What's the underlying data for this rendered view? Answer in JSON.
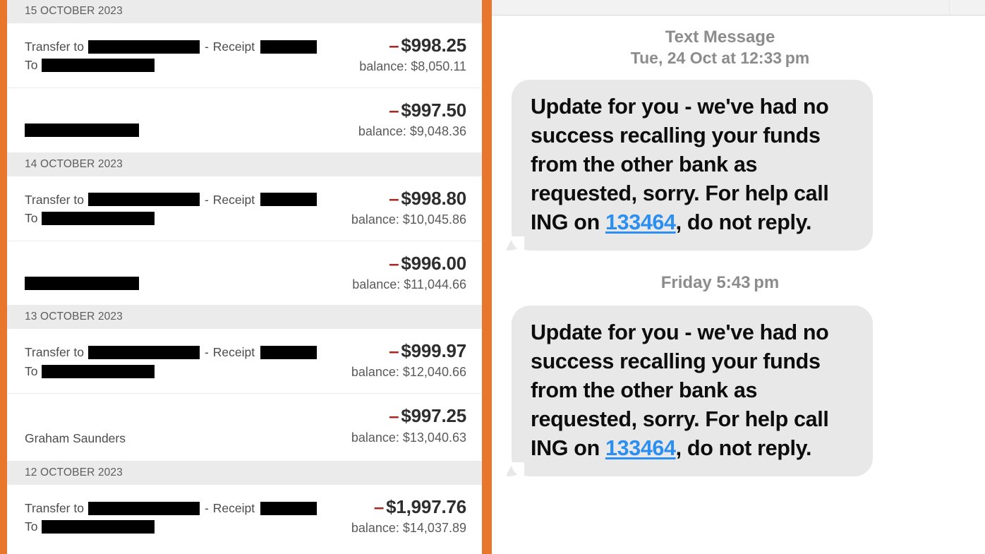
{
  "left_panel": {
    "name": "bank-transaction-list",
    "accent_color": "#e8762c",
    "date_header_bg": "#ebebeb",
    "amount_minus_color": "#a62a22",
    "groups": [
      {
        "date": "15 OCTOBER 2023",
        "transactions": [
          {
            "type": "transfer",
            "transfer_label": "Transfer to",
            "separator": "-",
            "receipt_label": "Receipt",
            "to_label": "To",
            "payee": "",
            "redacted": true,
            "minus": "–",
            "amount": "$998.25",
            "balance": "balance: $8,050.11"
          },
          {
            "type": "payee",
            "payee": "",
            "redacted": true,
            "minus": "–",
            "amount": "$997.50",
            "balance": "balance: $9,048.36"
          }
        ]
      },
      {
        "date": "14 OCTOBER 2023",
        "transactions": [
          {
            "type": "transfer",
            "transfer_label": "Transfer to",
            "separator": "-",
            "receipt_label": "Receipt",
            "to_label": "To",
            "payee": "",
            "redacted": true,
            "minus": "–",
            "amount": "$998.80",
            "balance": "balance: $10,045.86"
          },
          {
            "type": "payee",
            "payee": "",
            "redacted": true,
            "minus": "–",
            "amount": "$996.00",
            "balance": "balance: $11,044.66"
          }
        ]
      },
      {
        "date": "13 OCTOBER 2023",
        "transactions": [
          {
            "type": "transfer",
            "transfer_label": "Transfer to",
            "separator": "-",
            "receipt_label": "Receipt",
            "to_label": "To",
            "payee": "",
            "redacted": true,
            "minus": "–",
            "amount": "$999.97",
            "balance": "balance: $12,040.66"
          },
          {
            "type": "payee",
            "payee": "Graham Saunders",
            "redacted": false,
            "minus": "–",
            "amount": "$997.25",
            "balance": "balance: $13,040.63"
          }
        ]
      },
      {
        "date": "12 OCTOBER 2023",
        "transactions": [
          {
            "type": "transfer",
            "transfer_label": "Transfer to",
            "separator": "-",
            "receipt_label": "Receipt",
            "to_label": "To",
            "payee": "",
            "redacted": true,
            "minus": "–",
            "amount": "$1,997.76",
            "balance": "balance: $14,037.89"
          }
        ]
      }
    ]
  },
  "right_panel": {
    "name": "sms-conversation",
    "link_color": "#2a8ff0",
    "bubble_color": "#e8e8e8",
    "messages": [
      {
        "stamp_line1": "Text Message",
        "stamp_line2": "Tue, 24 Oct at 12:33 pm",
        "text_before_link": "Update for you - we've had no success recalling your funds from the other bank as requested, sorry. For help call ING on ",
        "link_text": "133464",
        "text_after_link": ", do not reply."
      },
      {
        "stamp_line1": "Friday 5:43 pm",
        "stamp_line2": "",
        "text_before_link": "Update for you - we've had no success recalling your funds from the other bank as requested, sorry. For help call ING on ",
        "link_text": "133464",
        "text_after_link": ", do not reply."
      }
    ]
  }
}
